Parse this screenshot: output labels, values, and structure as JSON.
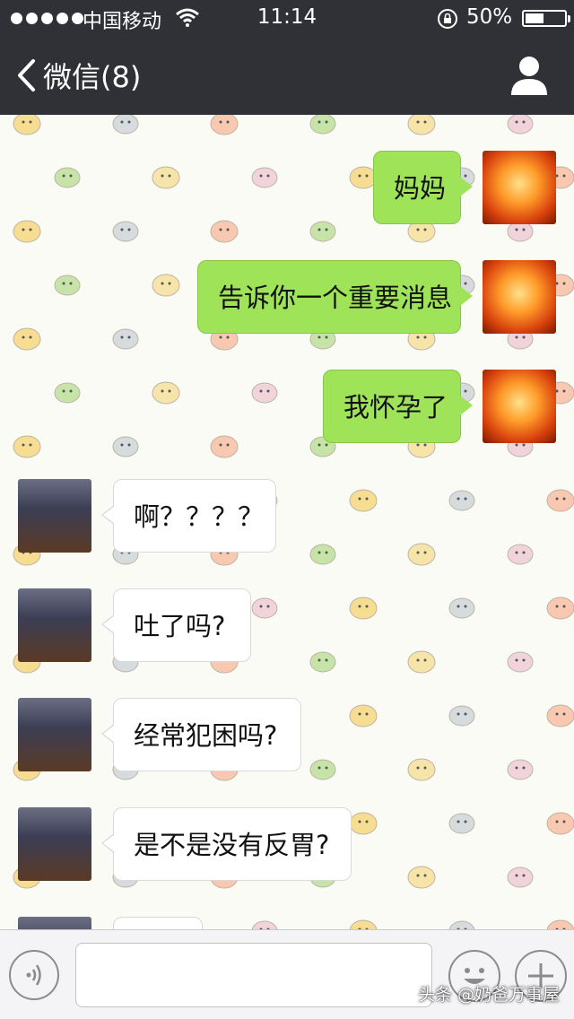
{
  "status_bar": {
    "carrier": "中国移动",
    "time": "11:14",
    "battery": "50%",
    "signal_bars": 5,
    "battery_level": 0.5
  },
  "nav": {
    "back_label": "微信(8)",
    "back_icon": "chevron-left-icon",
    "profile_icon": "person-icon"
  },
  "messages": [
    {
      "from": "self",
      "text": "妈妈"
    },
    {
      "from": "self",
      "text": "告诉你一个重要消息"
    },
    {
      "from": "self",
      "text": "我怀孕了"
    },
    {
      "from": "other",
      "text": "啊？？？？"
    },
    {
      "from": "other",
      "text": "吐了吗?"
    },
    {
      "from": "other",
      "text": "经常犯困吗?"
    },
    {
      "from": "other",
      "text": "是不是没有反胃?"
    }
  ],
  "input_bar": {
    "voice_icon": "voice-icon",
    "emoji_icon": "emoji-icon",
    "plus_icon": "plus-icon",
    "text_value": ""
  },
  "watermark": "头条 @奶爸万事屋",
  "colors": {
    "header_bg": "#2f3136",
    "self_bubble": "#9fe358",
    "other_bubble": "#ffffff"
  }
}
